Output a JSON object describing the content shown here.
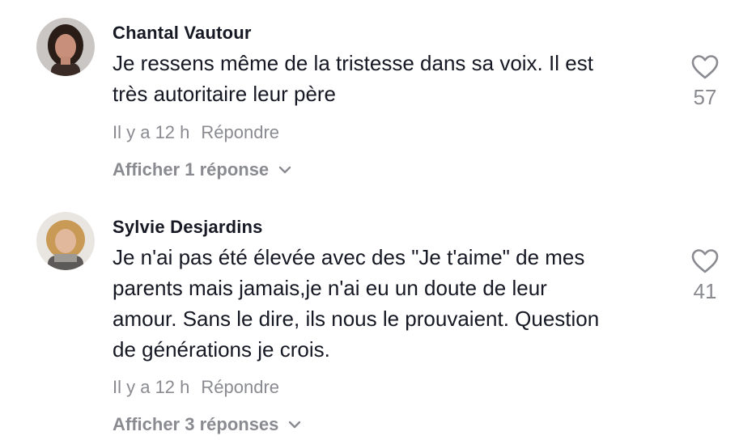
{
  "comments": [
    {
      "author": "Chantal Vautour",
      "lines": [
        "Je ressens même de la tristesse dans sa voix. Il est",
        "très autoritaire leur père"
      ],
      "time": "Il y a 12 h",
      "reply_label": "Répondre",
      "view_replies_label": "Afficher 1 réponse",
      "likes": "57"
    },
    {
      "author": "Sylvie Desjardins",
      "lines": [
        "Je n'ai pas été élevée avec des \"Je t'aime\" de mes",
        "parents mais jamais,je n'ai eu un doute de leur",
        "amour. Sans le dire, ils nous le prouvaient. Question",
        "de générations je crois."
      ],
      "time": "Il y a 12 h",
      "reply_label": "Répondre",
      "view_replies_label": "Afficher 3 réponses",
      "likes": "41"
    }
  ],
  "colors": {
    "text": "#161823",
    "muted": "#8a8b91",
    "background": "#ffffff"
  },
  "icons": [
    "heart-outline-icon",
    "chevron-down-icon"
  ]
}
